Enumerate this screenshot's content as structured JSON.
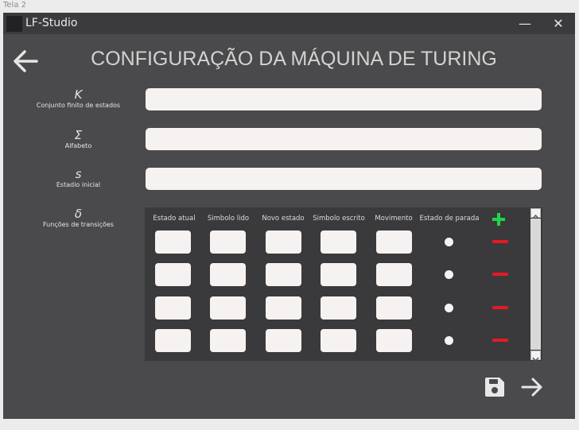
{
  "outer": {
    "tab_label": "Tela 2"
  },
  "window": {
    "title": "LF-Studio",
    "minimize_label": "—",
    "close_label": "✕"
  },
  "page": {
    "title": "CONFIGURAÇÃO DA MÁQUINA DE TURING"
  },
  "icons": {
    "back": "arrow-left-icon",
    "save": "floppy-disk-icon",
    "next": "arrow-right-icon",
    "add": "plus-icon",
    "remove": "minus-icon"
  },
  "fields": {
    "states": {
      "symbol": "K",
      "label": "Conjunto finito de estados",
      "value": ""
    },
    "alphabet": {
      "symbol": "Σ",
      "label": "Alfabeto",
      "value": ""
    },
    "initial": {
      "symbol": "s",
      "label": "Estadio inicial",
      "value": ""
    }
  },
  "transitions": {
    "symbol": "δ",
    "label": "Funções de transições",
    "columns": [
      "Estado atual",
      "Simbolo lido",
      "Novo estado",
      "Simbolo escrito",
      "Movimento",
      "Estado de parada"
    ],
    "rows": [
      {
        "estado_atual": "",
        "simbolo_lido": "",
        "novo_estado": "",
        "simbolo_escrito": "",
        "movimento": "",
        "estado_de_parada": false
      },
      {
        "estado_atual": "",
        "simbolo_lido": "",
        "novo_estado": "",
        "simbolo_escrito": "",
        "movimento": "",
        "estado_de_parada": false
      },
      {
        "estado_atual": "",
        "simbolo_lido": "",
        "novo_estado": "",
        "simbolo_escrito": "",
        "movimento": "",
        "estado_de_parada": false
      },
      {
        "estado_atual": "",
        "simbolo_lido": "",
        "novo_estado": "",
        "simbolo_escrito": "",
        "movimento": "",
        "estado_de_parada": false
      }
    ]
  },
  "colors": {
    "window_bg": "#4a4a4c",
    "titlebar_bg": "#3b3b3d",
    "panel_bg": "#3a3a3c",
    "input_bg": "#f6f2f1",
    "add_green": "#22d34d",
    "remove_red": "#e31b23"
  }
}
